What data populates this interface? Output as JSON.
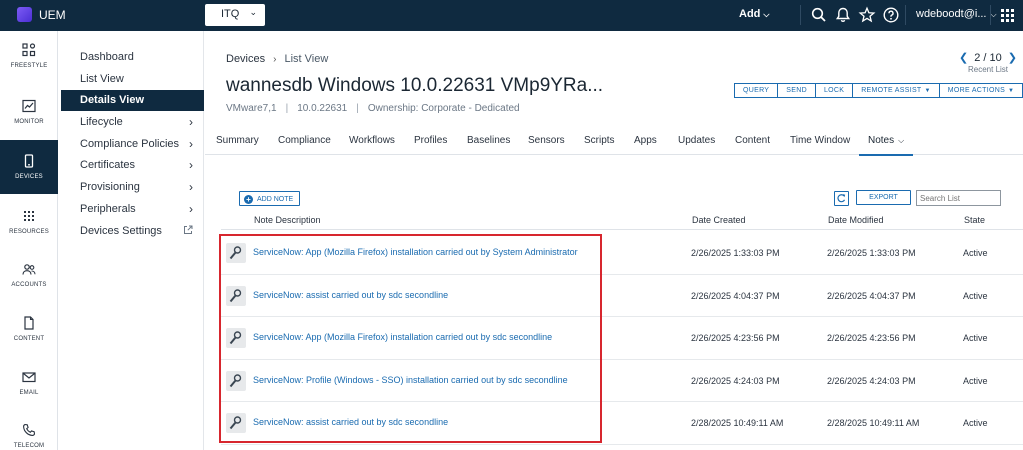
{
  "topbar": {
    "app_name": "UEM",
    "org_selector": "ITQ",
    "add_label": "Add",
    "user": "wdeboodt@i..."
  },
  "rail": [
    {
      "label": "FREESTYLE",
      "icon": "freestyle-icon"
    },
    {
      "label": "MONITOR",
      "icon": "monitor-icon"
    },
    {
      "label": "DEVICES",
      "icon": "devices-icon",
      "active": true
    },
    {
      "label": "RESOURCES",
      "icon": "resources-icon"
    },
    {
      "label": "ACCOUNTS",
      "icon": "accounts-icon"
    },
    {
      "label": "CONTENT",
      "icon": "content-icon"
    },
    {
      "label": "EMAIL",
      "icon": "email-icon"
    },
    {
      "label": "TELECOM",
      "icon": "telecom-icon"
    }
  ],
  "subnav": [
    {
      "label": "Dashboard"
    },
    {
      "label": "List View"
    },
    {
      "label": "Details View",
      "active": true
    },
    {
      "label": "Lifecycle",
      "arrow": true
    },
    {
      "label": "Compliance Policies",
      "arrow": true
    },
    {
      "label": "Certificates",
      "arrow": true
    },
    {
      "label": "Provisioning",
      "arrow": true
    },
    {
      "label": "Peripherals",
      "arrow": true
    },
    {
      "label": "Devices Settings",
      "external": true
    }
  ],
  "breadcrumb": {
    "root": "Devices",
    "current": "List View"
  },
  "device": {
    "title": "wannesdb Windows 10.0.22631 VMp9YRa...",
    "model": "VMware7,1",
    "os_version": "10.0.22631",
    "ownership": "Ownership: Corporate - Dedicated"
  },
  "pager": {
    "position": "2 / 10",
    "sub": "Recent List"
  },
  "actions": [
    "QUERY",
    "SEND",
    "LOCK",
    "REMOTE ASSIST",
    "MORE ACTIONS"
  ],
  "tabs": [
    "Summary",
    "Compliance",
    "Workflows",
    "Profiles",
    "Baselines",
    "Sensors",
    "Scripts",
    "Apps",
    "Updates",
    "Content",
    "Time Window",
    "Notes"
  ],
  "active_tab": "Notes",
  "toolbar": {
    "add_note": "ADD NOTE",
    "export": "EXPORT",
    "search_placeholder": "Search List"
  },
  "table": {
    "columns": [
      "Note Description",
      "Date Created",
      "Date Modified",
      "State"
    ],
    "rows": [
      {
        "desc": "ServiceNow: App (Mozilla Firefox) installation carried out by System Administrator",
        "created": "2/26/2025 1:33:03 PM",
        "modified": "2/26/2025 1:33:03 PM",
        "state": "Active"
      },
      {
        "desc": "ServiceNow: assist carried out by sdc secondline",
        "created": "2/26/2025 4:04:37 PM",
        "modified": "2/26/2025 4:04:37 PM",
        "state": "Active"
      },
      {
        "desc": "ServiceNow: App (Mozilla Firefox) installation carried out by sdc secondline",
        "created": "2/26/2025 4:23:56 PM",
        "modified": "2/26/2025 4:23:56 PM",
        "state": "Active"
      },
      {
        "desc": "ServiceNow: Profile (Windows - SSO) installation carried out by sdc secondline",
        "created": "2/26/2025 4:24:03 PM",
        "modified": "2/26/2025 4:24:03 PM",
        "state": "Active"
      },
      {
        "desc": "ServiceNow: assist carried out by sdc secondline",
        "created": "2/28/2025 10:49:11 AM",
        "modified": "2/28/2025 10:49:11 AM",
        "state": "Active"
      }
    ]
  },
  "colors": {
    "nav_dark": "#0f2a40",
    "link_blue": "#1a6bb0",
    "highlight_red": "#d7262e"
  }
}
